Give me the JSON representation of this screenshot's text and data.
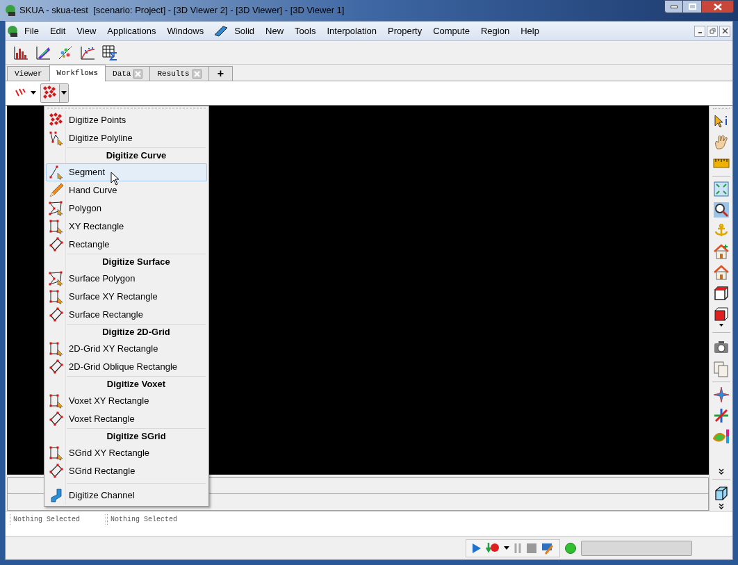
{
  "window": {
    "title": "SKUA - skua-test  [scenario: Project] - [3D Viewer 2] - [3D Viewer] - [3D Viewer 1]"
  },
  "menu_bar": [
    "File",
    "Edit",
    "View",
    "Applications",
    "Windows",
    "Solid",
    "New",
    "Tools",
    "Interpolation",
    "Property",
    "Compute",
    "Region",
    "Help"
  ],
  "tabs": [
    {
      "label": "Viewer",
      "selected": false,
      "closable": false
    },
    {
      "label": "Workflows",
      "selected": true,
      "closable": false
    },
    {
      "label": "Data",
      "selected": false,
      "closable": true
    },
    {
      "label": "Results",
      "selected": false,
      "closable": true
    },
    {
      "label": "+",
      "selected": false,
      "closable": false
    }
  ],
  "digitize_menu": [
    {
      "kind": "item",
      "label": "Digitize Points",
      "selected": false
    },
    {
      "kind": "item",
      "label": "Digitize Polyline",
      "selected": false
    },
    {
      "kind": "header",
      "label": "Digitize Curve"
    },
    {
      "kind": "item",
      "label": "Segment",
      "selected": true
    },
    {
      "kind": "item",
      "label": "Hand Curve",
      "selected": false
    },
    {
      "kind": "item",
      "label": "Polygon",
      "selected": false
    },
    {
      "kind": "item",
      "label": "XY Rectangle",
      "selected": false
    },
    {
      "kind": "item",
      "label": "Rectangle",
      "selected": false
    },
    {
      "kind": "header",
      "label": "Digitize Surface"
    },
    {
      "kind": "item",
      "label": "Surface Polygon",
      "selected": false
    },
    {
      "kind": "item",
      "label": "Surface XY Rectangle",
      "selected": false
    },
    {
      "kind": "item",
      "label": "Surface Rectangle",
      "selected": false
    },
    {
      "kind": "header",
      "label": "Digitize 2D-Grid"
    },
    {
      "kind": "item",
      "label": "2D-Grid XY Rectangle",
      "selected": false
    },
    {
      "kind": "item",
      "label": "2D-Grid Oblique Rectangle",
      "selected": false
    },
    {
      "kind": "header",
      "label": "Digitize Voxet"
    },
    {
      "kind": "item",
      "label": "Voxet XY Rectangle",
      "selected": false
    },
    {
      "kind": "item",
      "label": "Voxet Rectangle",
      "selected": false
    },
    {
      "kind": "header",
      "label": "Digitize SGrid"
    },
    {
      "kind": "item",
      "label": "SGrid XY Rectangle",
      "selected": false
    },
    {
      "kind": "item",
      "label": "SGrid Rectangle",
      "selected": false
    },
    {
      "kind": "separator"
    },
    {
      "kind": "item",
      "label": "Digitize Channel",
      "selected": false
    }
  ],
  "status": [
    "Nothing Selected",
    "Nothing Selected"
  ],
  "progress": {
    "level": 0
  }
}
